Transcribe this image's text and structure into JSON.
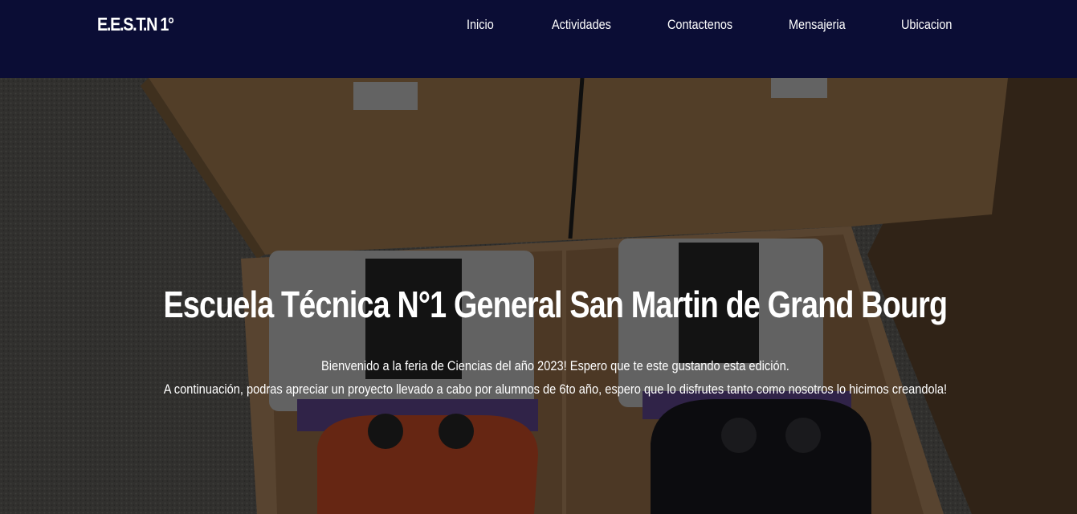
{
  "brand": {
    "text": "E.E.S.T.N 1°"
  },
  "nav": {
    "items": [
      {
        "label": "Inicio"
      },
      {
        "label": "Actividades"
      },
      {
        "label": "Contactenos"
      },
      {
        "label": "Mensajeria"
      },
      {
        "label": "Ubicacion"
      }
    ]
  },
  "hero": {
    "title": "Escuela Técnica N°1 General San Martin de Grand Bourg",
    "line1": "Bienvenido a la feria de Ciencias del año 2023! Espero que te este gustando esta edición.",
    "line2": "A continuación, podras apreciar un proyecto llevado a cabo por alumnos de 6to año, espero que lo disfrutes tanto como nosotros lo hicimos creandola!"
  },
  "colors": {
    "navbar_bg": "#0b0d35",
    "text": "#ffffff",
    "controller_left": "#e2552a",
    "controller_right": "#1c1c22"
  }
}
